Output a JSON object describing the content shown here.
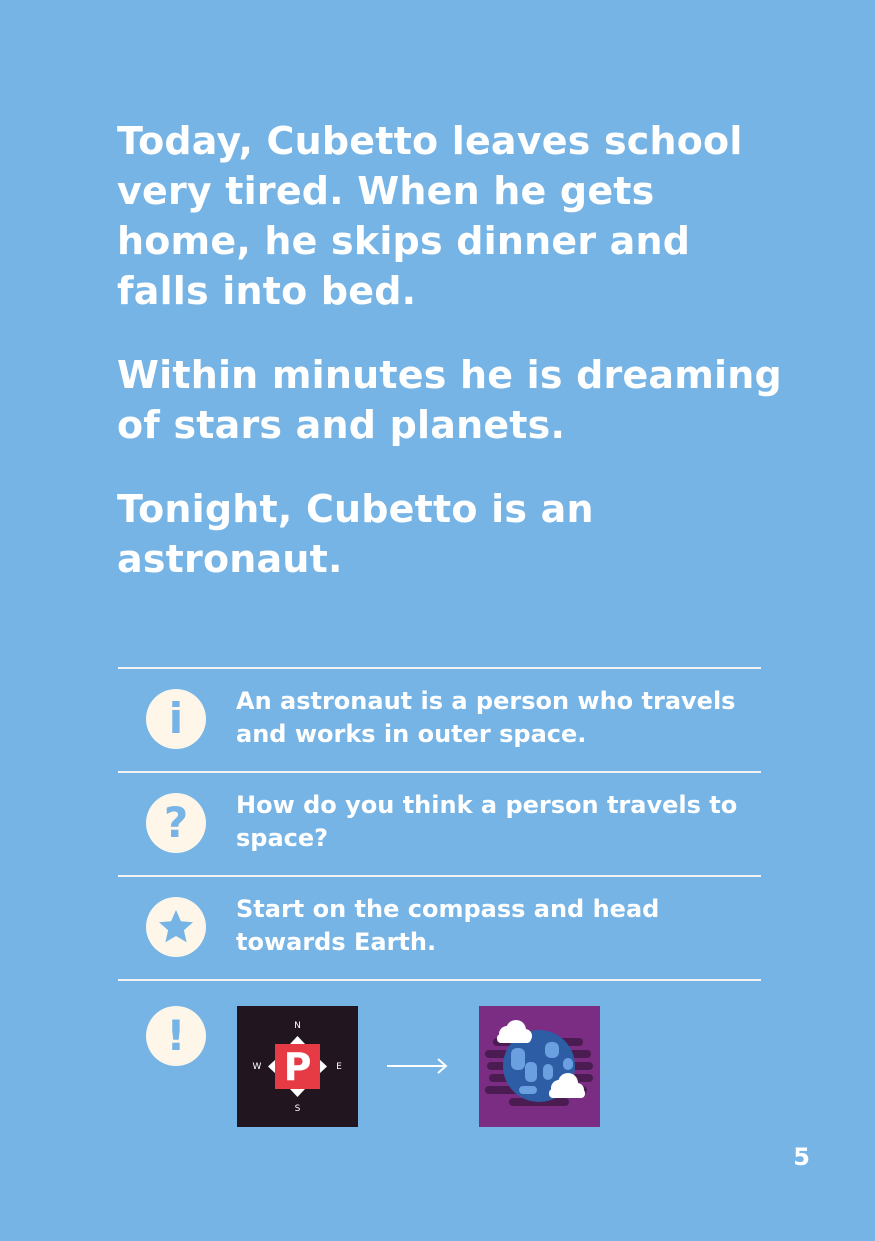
{
  "story": {
    "paragraph_1": "Today, Cubetto leaves school very tired. When he gets home, he skips dinner and falls into bed.",
    "paragraph_2": "Within minutes he is dreaming of stars and planets.",
    "paragraph_3": "Tonight, Cubetto is an astronaut."
  },
  "notes": [
    {
      "icon": "info-icon",
      "symbol": "i",
      "text": "An astronaut is a person who travels and works in outer space."
    },
    {
      "icon": "question-icon",
      "symbol": "?",
      "text": "How do you think a person travels to space?"
    },
    {
      "icon": "star-icon",
      "symbol": "",
      "text": "Start on the compass and head towards Earth."
    },
    {
      "icon": "exclamation-icon",
      "symbol": "!",
      "text": ""
    }
  ],
  "compass_tile": {
    "north": "N",
    "south": "S",
    "east": "E",
    "west": "W",
    "center_letter": "P"
  },
  "colors": {
    "page_background": "#76b4e6",
    "badge": "#fdf6e9",
    "compass_tile": "#21151f",
    "compass_center": "#e63a44",
    "earth_tile": "#7a2d82",
    "earth_planet": "#2d5ea5"
  },
  "page_number": "5"
}
